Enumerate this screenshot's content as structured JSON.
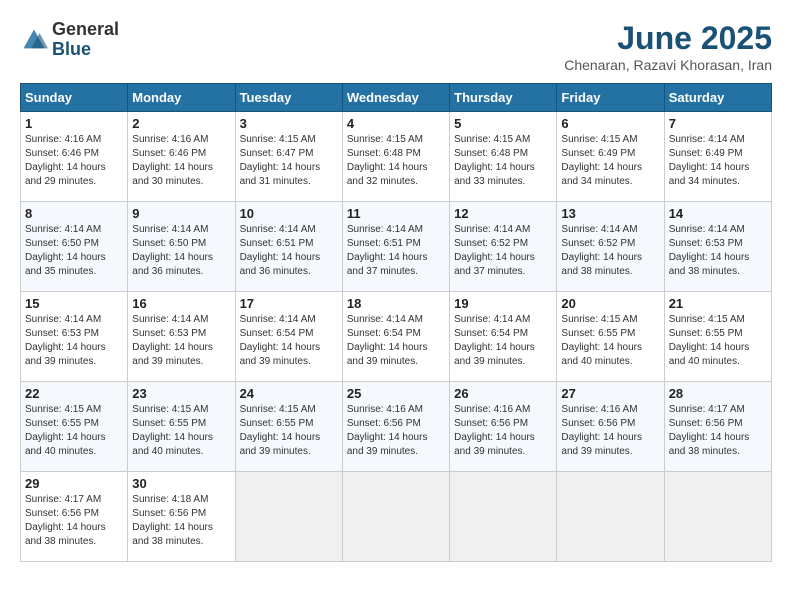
{
  "header": {
    "logo_general": "General",
    "logo_blue": "Blue",
    "month_title": "June 2025",
    "location": "Chenaran, Razavi Khorasan, Iran"
  },
  "weekdays": [
    "Sunday",
    "Monday",
    "Tuesday",
    "Wednesday",
    "Thursday",
    "Friday",
    "Saturday"
  ],
  "weeks": [
    [
      {
        "day": "1",
        "sunrise": "Sunrise: 4:16 AM",
        "sunset": "Sunset: 6:46 PM",
        "daylight": "Daylight: 14 hours and 29 minutes."
      },
      {
        "day": "2",
        "sunrise": "Sunrise: 4:16 AM",
        "sunset": "Sunset: 6:46 PM",
        "daylight": "Daylight: 14 hours and 30 minutes."
      },
      {
        "day": "3",
        "sunrise": "Sunrise: 4:15 AM",
        "sunset": "Sunset: 6:47 PM",
        "daylight": "Daylight: 14 hours and 31 minutes."
      },
      {
        "day": "4",
        "sunrise": "Sunrise: 4:15 AM",
        "sunset": "Sunset: 6:48 PM",
        "daylight": "Daylight: 14 hours and 32 minutes."
      },
      {
        "day": "5",
        "sunrise": "Sunrise: 4:15 AM",
        "sunset": "Sunset: 6:48 PM",
        "daylight": "Daylight: 14 hours and 33 minutes."
      },
      {
        "day": "6",
        "sunrise": "Sunrise: 4:15 AM",
        "sunset": "Sunset: 6:49 PM",
        "daylight": "Daylight: 14 hours and 34 minutes."
      },
      {
        "day": "7",
        "sunrise": "Sunrise: 4:14 AM",
        "sunset": "Sunset: 6:49 PM",
        "daylight": "Daylight: 14 hours and 34 minutes."
      }
    ],
    [
      {
        "day": "8",
        "sunrise": "Sunrise: 4:14 AM",
        "sunset": "Sunset: 6:50 PM",
        "daylight": "Daylight: 14 hours and 35 minutes."
      },
      {
        "day": "9",
        "sunrise": "Sunrise: 4:14 AM",
        "sunset": "Sunset: 6:50 PM",
        "daylight": "Daylight: 14 hours and 36 minutes."
      },
      {
        "day": "10",
        "sunrise": "Sunrise: 4:14 AM",
        "sunset": "Sunset: 6:51 PM",
        "daylight": "Daylight: 14 hours and 36 minutes."
      },
      {
        "day": "11",
        "sunrise": "Sunrise: 4:14 AM",
        "sunset": "Sunset: 6:51 PM",
        "daylight": "Daylight: 14 hours and 37 minutes."
      },
      {
        "day": "12",
        "sunrise": "Sunrise: 4:14 AM",
        "sunset": "Sunset: 6:52 PM",
        "daylight": "Daylight: 14 hours and 37 minutes."
      },
      {
        "day": "13",
        "sunrise": "Sunrise: 4:14 AM",
        "sunset": "Sunset: 6:52 PM",
        "daylight": "Daylight: 14 hours and 38 minutes."
      },
      {
        "day": "14",
        "sunrise": "Sunrise: 4:14 AM",
        "sunset": "Sunset: 6:53 PM",
        "daylight": "Daylight: 14 hours and 38 minutes."
      }
    ],
    [
      {
        "day": "15",
        "sunrise": "Sunrise: 4:14 AM",
        "sunset": "Sunset: 6:53 PM",
        "daylight": "Daylight: 14 hours and 39 minutes."
      },
      {
        "day": "16",
        "sunrise": "Sunrise: 4:14 AM",
        "sunset": "Sunset: 6:53 PM",
        "daylight": "Daylight: 14 hours and 39 minutes."
      },
      {
        "day": "17",
        "sunrise": "Sunrise: 4:14 AM",
        "sunset": "Sunset: 6:54 PM",
        "daylight": "Daylight: 14 hours and 39 minutes."
      },
      {
        "day": "18",
        "sunrise": "Sunrise: 4:14 AM",
        "sunset": "Sunset: 6:54 PM",
        "daylight": "Daylight: 14 hours and 39 minutes."
      },
      {
        "day": "19",
        "sunrise": "Sunrise: 4:14 AM",
        "sunset": "Sunset: 6:54 PM",
        "daylight": "Daylight: 14 hours and 39 minutes."
      },
      {
        "day": "20",
        "sunrise": "Sunrise: 4:15 AM",
        "sunset": "Sunset: 6:55 PM",
        "daylight": "Daylight: 14 hours and 40 minutes."
      },
      {
        "day": "21",
        "sunrise": "Sunrise: 4:15 AM",
        "sunset": "Sunset: 6:55 PM",
        "daylight": "Daylight: 14 hours and 40 minutes."
      }
    ],
    [
      {
        "day": "22",
        "sunrise": "Sunrise: 4:15 AM",
        "sunset": "Sunset: 6:55 PM",
        "daylight": "Daylight: 14 hours and 40 minutes."
      },
      {
        "day": "23",
        "sunrise": "Sunrise: 4:15 AM",
        "sunset": "Sunset: 6:55 PM",
        "daylight": "Daylight: 14 hours and 40 minutes."
      },
      {
        "day": "24",
        "sunrise": "Sunrise: 4:15 AM",
        "sunset": "Sunset: 6:55 PM",
        "daylight": "Daylight: 14 hours and 39 minutes."
      },
      {
        "day": "25",
        "sunrise": "Sunrise: 4:16 AM",
        "sunset": "Sunset: 6:56 PM",
        "daylight": "Daylight: 14 hours and 39 minutes."
      },
      {
        "day": "26",
        "sunrise": "Sunrise: 4:16 AM",
        "sunset": "Sunset: 6:56 PM",
        "daylight": "Daylight: 14 hours and 39 minutes."
      },
      {
        "day": "27",
        "sunrise": "Sunrise: 4:16 AM",
        "sunset": "Sunset: 6:56 PM",
        "daylight": "Daylight: 14 hours and 39 minutes."
      },
      {
        "day": "28",
        "sunrise": "Sunrise: 4:17 AM",
        "sunset": "Sunset: 6:56 PM",
        "daylight": "Daylight: 14 hours and 38 minutes."
      }
    ],
    [
      {
        "day": "29",
        "sunrise": "Sunrise: 4:17 AM",
        "sunset": "Sunset: 6:56 PM",
        "daylight": "Daylight: 14 hours and 38 minutes."
      },
      {
        "day": "30",
        "sunrise": "Sunrise: 4:18 AM",
        "sunset": "Sunset: 6:56 PM",
        "daylight": "Daylight: 14 hours and 38 minutes."
      },
      null,
      null,
      null,
      null,
      null
    ]
  ]
}
